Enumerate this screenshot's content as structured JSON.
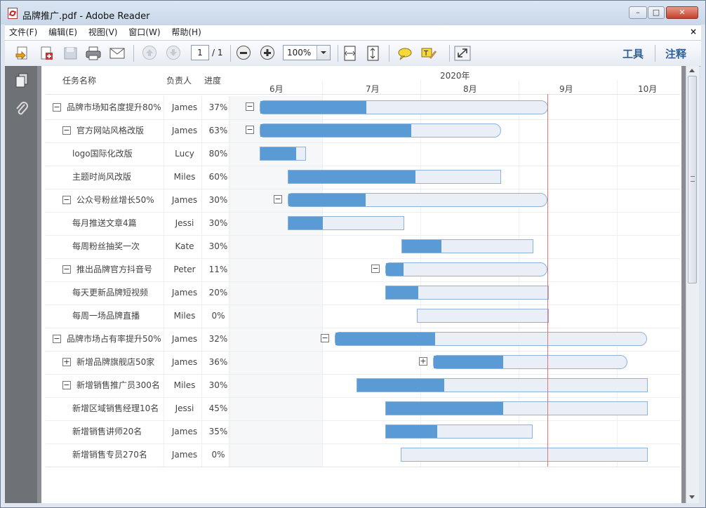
{
  "window": {
    "title": "品牌推广.pdf - Adobe Reader"
  },
  "menu": [
    "文件(F)",
    "编辑(E)",
    "视图(V)",
    "窗口(W)",
    "帮助(H)"
  ],
  "menu_close": "×",
  "toolbar": {
    "page_current": "1",
    "page_total": "/ 1",
    "zoom": "100%",
    "tools_label": "工具",
    "comment_label": "注释"
  },
  "gantt": {
    "col_task": "任务名称",
    "col_owner": "负责人",
    "col_progress": "进度",
    "year": "2020年",
    "months": [
      "6月",
      "7月",
      "8月",
      "9月",
      "10月"
    ],
    "rows": [
      {
        "name": "品牌市场知名度提升80%",
        "owner": "James",
        "progress": "37%",
        "pct": 37,
        "level": 0,
        "toggle": "−",
        "summary": true
      },
      {
        "name": "官方网站风格改版",
        "owner": "James",
        "progress": "63%",
        "pct": 63,
        "level": 1,
        "toggle": "−",
        "summary": true
      },
      {
        "name": "logo国际化改版",
        "owner": "Lucy",
        "progress": "80%",
        "pct": 80,
        "level": 2,
        "toggle": "",
        "summary": false
      },
      {
        "name": "主题时尚风改版",
        "owner": "Miles",
        "progress": "60%",
        "pct": 60,
        "level": 2,
        "toggle": "",
        "summary": false
      },
      {
        "name": "公众号粉丝增长50%",
        "owner": "James",
        "progress": "30%",
        "pct": 30,
        "level": 1,
        "toggle": "−",
        "summary": true
      },
      {
        "name": "每月推送文章4篇",
        "owner": "Jessi",
        "progress": "30%",
        "pct": 30,
        "level": 2,
        "toggle": "",
        "summary": false
      },
      {
        "name": "每周粉丝抽奖一次",
        "owner": "Kate",
        "progress": "30%",
        "pct": 30,
        "level": 2,
        "toggle": "",
        "summary": false
      },
      {
        "name": "推出品牌官方抖音号",
        "owner": "Peter",
        "progress": "11%",
        "pct": 11,
        "level": 1,
        "toggle": "−",
        "summary": true
      },
      {
        "name": "每天更新品牌短视频",
        "owner": "James",
        "progress": "20%",
        "pct": 20,
        "level": 2,
        "toggle": "",
        "summary": false
      },
      {
        "name": "每周一场品牌直播",
        "owner": "Miles",
        "progress": "0%",
        "pct": 0,
        "level": 2,
        "toggle": "",
        "summary": false
      },
      {
        "name": "品牌市场占有率提升50%",
        "owner": "James",
        "progress": "32%",
        "pct": 32,
        "level": 0,
        "toggle": "−",
        "summary": true
      },
      {
        "name": "新增品牌旗舰店50家",
        "owner": "James",
        "progress": "36%",
        "pct": 36,
        "level": 1,
        "toggle": "+",
        "summary": true
      },
      {
        "name": "新增销售推广员300名",
        "owner": "Miles",
        "progress": "30%",
        "pct": 30,
        "level": 1,
        "toggle": "−",
        "summary": false
      },
      {
        "name": "新增区域销售经理10名",
        "owner": "Jessi",
        "progress": "45%",
        "pct": 45,
        "level": 2,
        "toggle": "",
        "summary": false
      },
      {
        "name": "新增销售讲师20名",
        "owner": "James",
        "progress": "35%",
        "pct": 35,
        "level": 2,
        "toggle": "",
        "summary": false
      },
      {
        "name": "新增销售专员270名",
        "owner": "James",
        "progress": "0%",
        "pct": 0,
        "level": 2,
        "toggle": "",
        "summary": false
      }
    ]
  },
  "colors": {
    "bar_fill": "#5b9bd5",
    "bar_bg": "#e9eef7",
    "today_line": "#e57373"
  }
}
